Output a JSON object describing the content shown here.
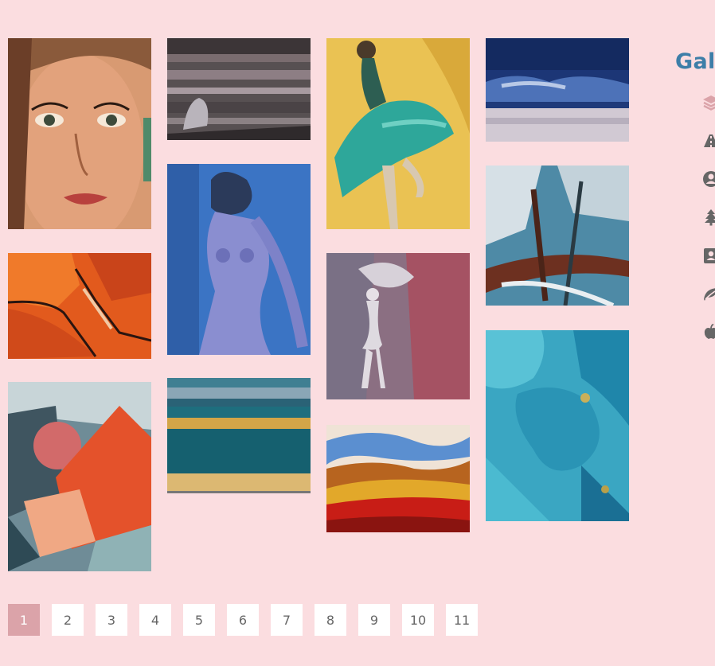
{
  "sidebar": {
    "title": "Gale",
    "icons": [
      "layers-icon",
      "road-icon",
      "user-circle-icon",
      "tree-icon",
      "contact-card-icon",
      "leaf-icon",
      "apple-icon"
    ]
  },
  "gallery": {
    "paintings": [
      {
        "id": "woman-portrait",
        "subject": "Woman face portrait"
      },
      {
        "id": "figure-gray-shore",
        "subject": "Crouching figure on gray shore"
      },
      {
        "id": "dancer-teal-dress",
        "subject": "Dancer in teal dress on yellow"
      },
      {
        "id": "blue-sea-horizon",
        "subject": "Blue sky over sea"
      },
      {
        "id": "orange-abstract",
        "subject": "Orange abstract with black lines"
      },
      {
        "id": "blue-nude",
        "subject": "Blue seated nude"
      },
      {
        "id": "abstract-white-splash",
        "subject": "Abstract white and blue splash"
      },
      {
        "id": "ballerina-mauve",
        "subject": "Ballerina on mauve background"
      },
      {
        "id": "geometric-red-shapes",
        "subject": "Geometric red shapes"
      },
      {
        "id": "teal-stripes",
        "subject": "Teal and ochre stripes"
      },
      {
        "id": "turquoise-abstract",
        "subject": "Turquoise abstract"
      },
      {
        "id": "landscape-red-dunes",
        "subject": "Red dune landscape"
      }
    ]
  },
  "pagination": {
    "current": 1,
    "pages": [
      "1",
      "2",
      "3",
      "4",
      "5",
      "6",
      "7",
      "8",
      "9",
      "10",
      "11"
    ]
  },
  "colors": {
    "background": "#fbdde0",
    "title": "#3d7ea8",
    "active_icon": "#dba3a9",
    "icon": "#666666",
    "active_page": "#dba3a9"
  }
}
